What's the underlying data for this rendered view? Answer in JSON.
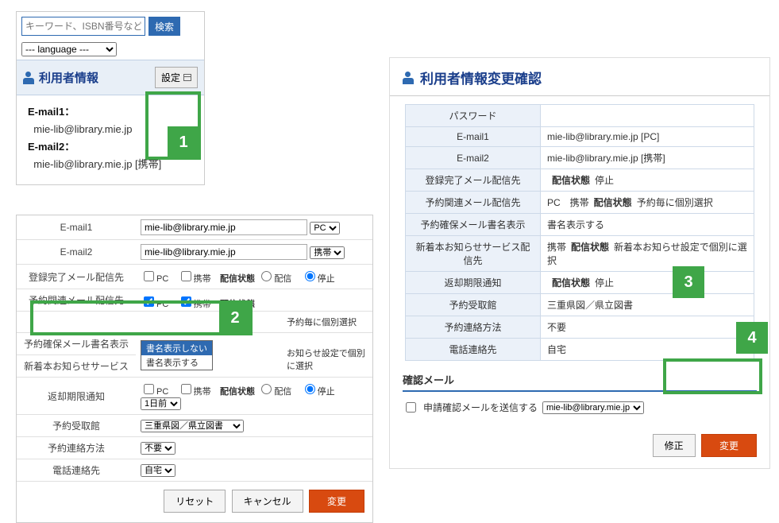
{
  "search": {
    "placeholder": "キーワード、ISBN番号など",
    "button": "検索"
  },
  "language_selected": "--- language ---",
  "panel1": {
    "title": "利用者情報",
    "settings_btn": "設定",
    "email1_label": "E-mail1：",
    "email1_value": "mie-lib@library.mie.jp",
    "email2_label": "E-mail2：",
    "email2_value": "mie-lib@library.mie.jp [携帯]"
  },
  "panel2": {
    "rows": {
      "email1": {
        "label": "E-mail1",
        "value": "mie-lib@library.mie.jp",
        "type": "PC"
      },
      "email2": {
        "label": "E-mail2",
        "value": "mie-lib@library.mie.jp",
        "type": "携帯"
      },
      "regcomplete": {
        "label": "登録完了メール配信先",
        "pc": "PC",
        "keitai": "携帯",
        "status_lbl": "配信状態",
        "o_on": "配信",
        "o_off": "停止"
      },
      "yoyaku_related": {
        "label": "予約関連メール配信先",
        "pc": "PC",
        "keitai": "携帯",
        "status_lbl": "配信状態",
        "trail": "予約毎に個別選択"
      },
      "yoyaku_hold": {
        "label": "予約確保メール書名表示",
        "opt_hide": "書名表示しない",
        "opt_show": "書名表示する"
      },
      "newbook": {
        "label": "新着本お知らせサービス",
        "trail": "お知らせ設定で個別に選択"
      },
      "returndue": {
        "label": "返却期限通知",
        "pc": "PC",
        "keitai": "携帯",
        "status_lbl": "配信状態",
        "o_on": "配信",
        "o_off": "停止",
        "days": "1日前"
      },
      "pickup": {
        "label": "予約受取館",
        "value": "三重県図／県立図書"
      },
      "contact": {
        "label": "予約連絡方法",
        "value": "不要"
      },
      "tel": {
        "label": "電話連絡先",
        "value": "自宅"
      }
    },
    "buttons": {
      "reset": "リセット",
      "cancel": "キャンセル",
      "submit": "変更"
    }
  },
  "panel3": {
    "title": "利用者情報変更確認",
    "rows": [
      {
        "k": "パスワード",
        "v": ""
      },
      {
        "k": "E-mail1",
        "v": "mie-lib@library.mie.jp [PC]"
      },
      {
        "k": "E-mail2",
        "v": "mie-lib@library.mie.jp [携帯]"
      },
      {
        "k": "登録完了メール配信先",
        "v_pre": "",
        "status_lbl": "配信状態",
        "v_post": "停止"
      },
      {
        "k": "予約関連メール配信先",
        "v_pre": "PC　携帯",
        "status_lbl": "配信状態",
        "v_post": "予約毎に個別選択"
      },
      {
        "k": "予約確保メール書名表示",
        "v": "書名表示する"
      },
      {
        "k": "新着本お知らせサービス配信先",
        "v_pre": "携帯",
        "status_lbl": "配信状態",
        "v_post": "新着本お知らせ設定で個別に選択"
      },
      {
        "k": "返却期限通知",
        "v_pre": "",
        "status_lbl": "配信状態",
        "v_post": "停止"
      },
      {
        "k": "予約受取館",
        "v": "三重県図／県立図書"
      },
      {
        "k": "予約連絡方法",
        "v": "不要"
      },
      {
        "k": "電話連絡先",
        "v": "自宅"
      }
    ],
    "confirm_header": "確認メール",
    "confirm_checkbox": "申請確認メールを送信する",
    "confirm_select": "mie-lib@library.mie.jp",
    "buttons": {
      "edit": "修正",
      "submit": "変更"
    }
  },
  "callouts": {
    "n1": "1",
    "n2": "2",
    "n3": "3",
    "n4": "4"
  }
}
